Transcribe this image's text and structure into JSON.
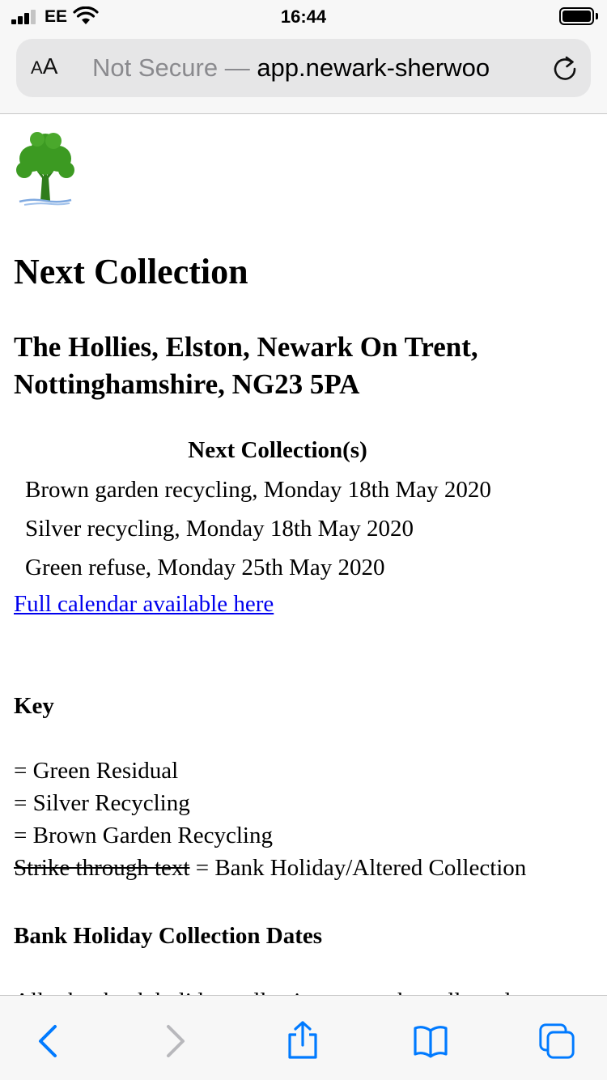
{
  "status_bar": {
    "carrier": "EE",
    "time": "16:44"
  },
  "address_bar": {
    "reader_small": "A",
    "reader_large": "A",
    "security": "Not Secure",
    "separator": " — ",
    "url": "app.newark-sherwoo"
  },
  "page": {
    "title": "Next Collection",
    "address_line1": "The Hollies, Elston, Newark On Trent,",
    "address_line2": "Nottinghamshire, NG23 5PA",
    "collections_title": "Next Collection(s)",
    "collections": [
      "Brown garden recycling, Monday 18th May 2020",
      "Silver recycling, Monday 18th May 2020",
      "Green refuse, Monday 25th May 2020"
    ],
    "calendar_link": "Full calendar available here",
    "key_title": "Key",
    "key_items": [
      "= Green Residual",
      "= Silver Recycling",
      "= Brown Garden Recycling"
    ],
    "strike_example": "Strike through text",
    "strike_meaning": " = Bank Holiday/Altered Collection",
    "bank_holiday_title": "Bank Holiday Collection Dates",
    "bank_holiday_text": "All other bank holiday collections are to be collected on"
  },
  "toolbar": {
    "icons": [
      "back-icon",
      "forward-icon",
      "share-icon",
      "bookmarks-icon",
      "tabs-icon"
    ]
  },
  "colors": {
    "link": "#0000ee",
    "ios_blue": "#007aff",
    "tree_green": "#3c9a22"
  }
}
